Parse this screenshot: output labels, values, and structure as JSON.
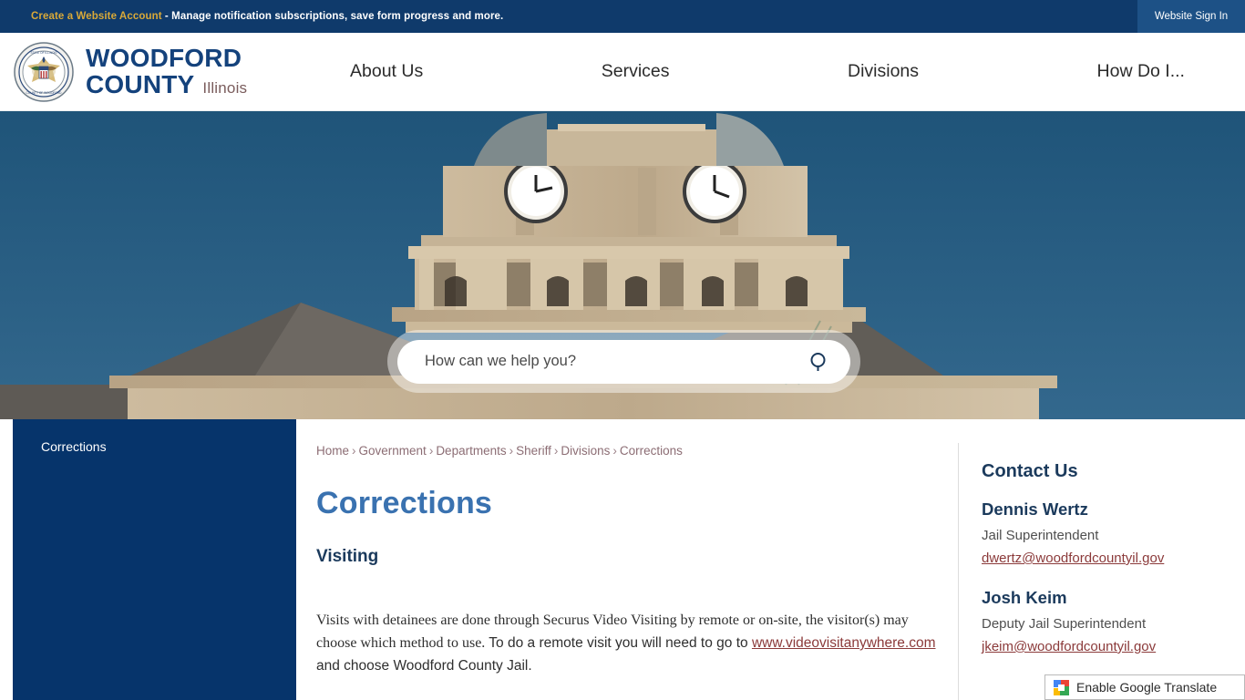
{
  "topbar": {
    "account_link": "Create a Website Account",
    "message": " - Manage notification subscriptions, save form progress and more.",
    "signin_label": "Website Sign In",
    "bg_color": "#0f3a6b",
    "link_color": "#d9a938"
  },
  "header": {
    "logo": {
      "line1": "WOODFORD",
      "line2": "COUNTY",
      "state": "Illinois",
      "seal_icon": "county-seal-eagle-icon",
      "color": "#14427c"
    },
    "nav": [
      {
        "label": "About Us"
      },
      {
        "label": "Services"
      },
      {
        "label": "Divisions"
      },
      {
        "label": "How Do I..."
      }
    ]
  },
  "hero": {
    "image_description": "courthouse-clock-tower-photo",
    "sky_color": "#2b5d84",
    "stone_color": "#c9b89d",
    "search": {
      "placeholder": "How can we help you?",
      "value": "",
      "button_icon": "search-icon"
    }
  },
  "sidebar": {
    "items": [
      {
        "label": "Corrections"
      }
    ],
    "bg_color": "#06346b"
  },
  "breadcrumb": {
    "separator": "›",
    "items": [
      {
        "label": "Home"
      },
      {
        "label": "Government"
      },
      {
        "label": "Departments"
      },
      {
        "label": "Sheriff"
      },
      {
        "label": "Divisions"
      },
      {
        "label": "Corrections"
      }
    ]
  },
  "main": {
    "title": "Corrections",
    "title_color": "#3a72b0",
    "subheading": "Visiting",
    "paragraph_part1": " Visits with detainees are done through Securus Video Visiting by remote or on-site, the visitor(s) may choose which method to use. ",
    "paragraph_part2": " To do a remote visit you will need to go to ",
    "link_text": "www.videovisitanywhere.com",
    "paragraph_part3": " and choose Woodford County Jail."
  },
  "contact": {
    "title": "Contact Us",
    "people": [
      {
        "name": "Dennis Wertz",
        "role": "Jail Superintendent",
        "email": "dwertz@woodfordcountyil.gov"
      },
      {
        "name": "Josh Keim",
        "role": "Deputy Jail Superintendent",
        "email": "jkeim@woodfordcountyil.gov"
      }
    ],
    "link_color": "#8b3a3a"
  },
  "translate_widget": {
    "label": "Enable Google Translate",
    "icon": "google-translate-icon"
  }
}
